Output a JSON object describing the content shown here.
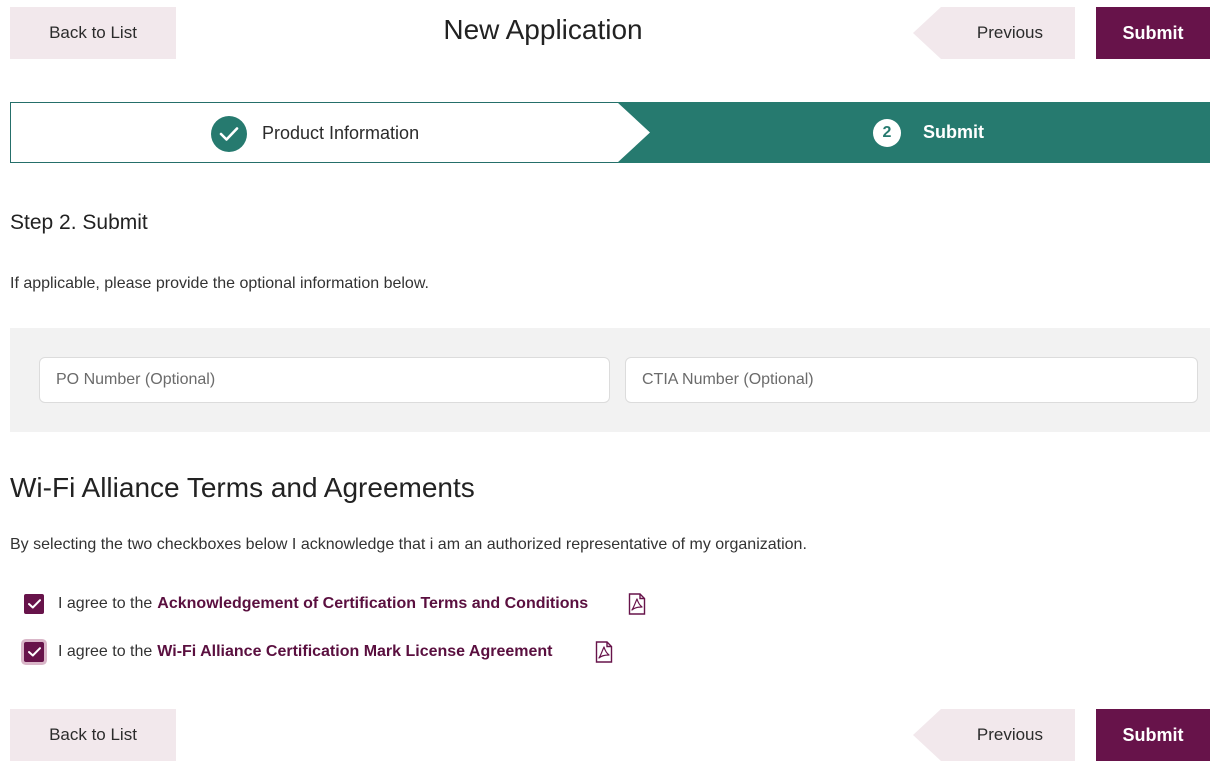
{
  "header": {
    "back_label": "Back to List",
    "title": "New Application",
    "previous_label": "Previous",
    "submit_label": "Submit"
  },
  "stepper": {
    "step1_label": "Product Information",
    "step2_number": "2",
    "step2_label": "Submit"
  },
  "content": {
    "step_heading": "Step 2. Submit",
    "intro": "If applicable, please provide the optional information below.",
    "po_placeholder": "PO Number (Optional)",
    "ctia_placeholder": "CTIA Number (Optional)"
  },
  "terms": {
    "heading": "Wi-Fi Alliance Terms and Agreements",
    "description": "By selecting the two checkboxes below I acknowledge that i am an authorized representative of my organization.",
    "agreements": [
      {
        "prefix": "I agree to the",
        "link": "Acknowledgement of Certification Terms and Conditions",
        "checked": true
      },
      {
        "prefix": "I agree to the",
        "link": "Wi-Fi Alliance Certification Mark License Agreement",
        "checked": true
      }
    ]
  },
  "footer": {
    "back_label": "Back to List",
    "previous_label": "Previous",
    "submit_label": "Submit"
  },
  "icons": {
    "step_complete": "check-icon",
    "checkbox": "checkmark-icon",
    "document": "pdf-file-icon"
  },
  "colors": {
    "primary": "#67134a",
    "stepper_teal": "#267a6f",
    "secondary_button": "#f2e8ec",
    "panel": "#f2f2f2"
  }
}
